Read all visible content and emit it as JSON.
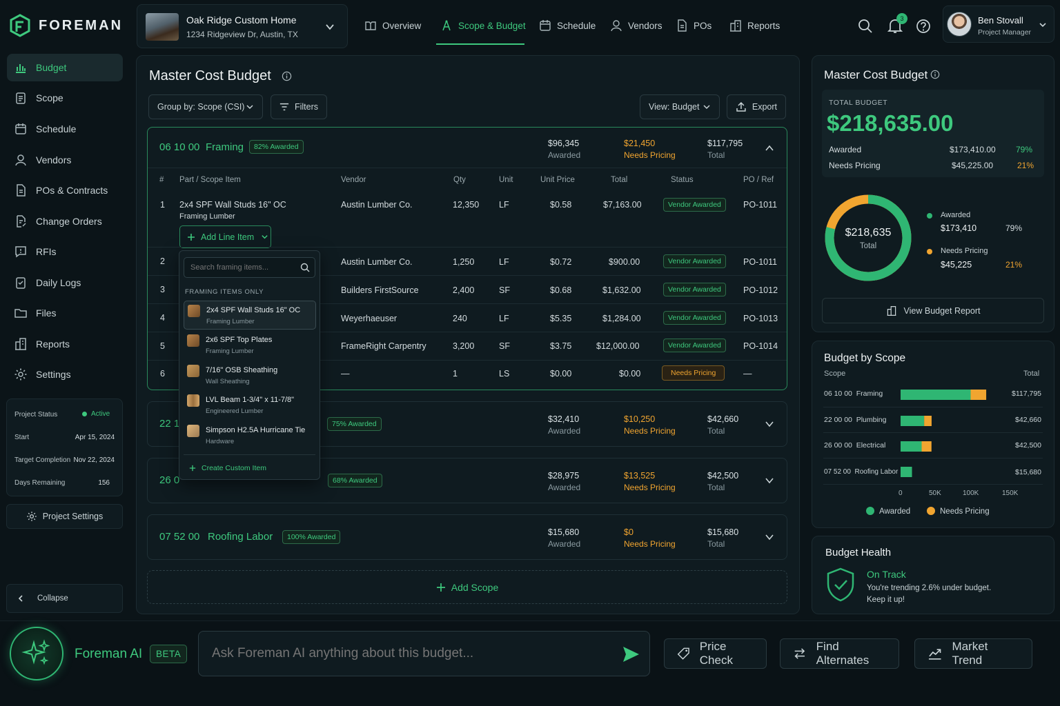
{
  "brand": {
    "name": "FOREMAN"
  },
  "project": {
    "name": "Oak Ridge Custom Home",
    "address": "1234 Ridgeview Dr, Austin, TX"
  },
  "topnav": [
    {
      "label": "Overview"
    },
    {
      "label": "Scope & Budget"
    },
    {
      "label": "Schedule"
    },
    {
      "label": "Vendors"
    },
    {
      "label": "POs"
    },
    {
      "label": "Reports"
    }
  ],
  "notifications": {
    "count": "3"
  },
  "user": {
    "name": "Ben Stovall",
    "role": "Project Manager"
  },
  "sidebar": {
    "items": [
      {
        "label": "Budget"
      },
      {
        "label": "Scope"
      },
      {
        "label": "Schedule"
      },
      {
        "label": "Vendors"
      },
      {
        "label": "POs & Contracts"
      },
      {
        "label": "Change Orders"
      },
      {
        "label": "RFIs"
      },
      {
        "label": "Daily Logs"
      },
      {
        "label": "Files"
      },
      {
        "label": "Reports"
      },
      {
        "label": "Settings"
      }
    ],
    "status": {
      "project_status_label": "Project Status",
      "project_status": "Active",
      "start_label": "Start",
      "start": "Apr 15, 2024",
      "target_label": "Target Completion",
      "target": "Nov 22, 2024",
      "days_label": "Days Remaining",
      "days": "156"
    },
    "project_settings": "Project Settings",
    "collapse": "Collapse"
  },
  "main": {
    "title": "Master Cost Budget",
    "group_by_label": "Group by:",
    "group_by_value": "Scope (CSI)",
    "filters": "Filters",
    "view_label": "View:",
    "view_value": "Budget",
    "export": "Export",
    "add_scope": "Add Scope"
  },
  "scopes": [
    {
      "code": "06 10 00",
      "name": "Framing",
      "awarded_pct": "82% Awarded",
      "awarded": "$96,345",
      "awarded_label": "Awarded",
      "needs": "$21,450",
      "needs_label": "Needs Pricing",
      "total": "$117,795",
      "total_label": "Total"
    },
    {
      "code": "22 1",
      "name": "",
      "awarded_pct": "75% Awarded",
      "awarded": "$32,410",
      "awarded_label": "Awarded",
      "needs": "$10,250",
      "needs_label": "Needs Pricing",
      "total": "$42,660",
      "total_label": "Total"
    },
    {
      "code": "26 0",
      "name": "",
      "awarded_pct": "68% Awarded",
      "awarded": "$28,975",
      "awarded_label": "Awarded",
      "needs": "$13,525",
      "needs_label": "Needs Pricing",
      "total": "$42,500",
      "total_label": "Total"
    },
    {
      "code": "07 52 00",
      "name": "Roofing Labor",
      "awarded_pct": "100% Awarded",
      "awarded": "$15,680",
      "awarded_label": "Awarded",
      "needs": "$0",
      "needs_label": "Needs Pricing",
      "total": "$15,680",
      "total_label": "Total"
    }
  ],
  "table": {
    "headers": [
      "#",
      "Part / Scope Item",
      "Vendor",
      "Qty",
      "Unit",
      "Unit Price",
      "Total",
      "Status",
      "PO / Ref"
    ],
    "rows": [
      {
        "n": "1",
        "item": "2x4 SPF Wall Studs 16\" OC",
        "sub": "Framing Lumber",
        "vendor": "Austin Lumber Co.",
        "qty": "12,350",
        "unit": "LF",
        "price": "$0.58",
        "total": "$7,163.00",
        "status": "Vendor Awarded",
        "po": "PO-1011"
      },
      {
        "n": "2",
        "vendor": "Austin Lumber Co.",
        "qty": "1,250",
        "unit": "LF",
        "price": "$0.72",
        "total": "$900.00",
        "status": "Vendor Awarded",
        "po": "PO-1011"
      },
      {
        "n": "3",
        "vendor": "Builders FirstSource",
        "qty": "2,400",
        "unit": "SF",
        "price": "$0.68",
        "total": "$1,632.00",
        "status": "Vendor Awarded",
        "po": "PO-1012"
      },
      {
        "n": "4",
        "vendor": "Weyerhaeuser",
        "qty": "240",
        "unit": "LF",
        "price": "$5.35",
        "total": "$1,284.00",
        "status": "Vendor Awarded",
        "po": "PO-1013"
      },
      {
        "n": "5",
        "vendor": "FrameRight Carpentry",
        "qty": "3,200",
        "unit": "SF",
        "price": "$3.75",
        "total": "$12,000.00",
        "status": "Vendor Awarded",
        "po": "PO-1014"
      },
      {
        "n": "6",
        "vendor": "—",
        "qty": "1",
        "unit": "LS",
        "price": "$0.00",
        "total": "$0.00",
        "status": "Needs Pricing",
        "po": "—"
      }
    ],
    "add_line_item": "Add Line Item"
  },
  "dropdown": {
    "search_placeholder": "Search framing items...",
    "section": "FRAMING ITEMS ONLY",
    "items": [
      {
        "name": "2x4 SPF Wall Studs 16\" OC",
        "cat": "Framing Lumber"
      },
      {
        "name": "2x6 SPF Top Plates",
        "cat": "Framing Lumber"
      },
      {
        "name": "7/16\" OSB Sheathing",
        "cat": "Wall Sheathing"
      },
      {
        "name": "LVL Beam 1-3/4\" x 11-7/8\"",
        "cat": "Engineered Lumber"
      },
      {
        "name": "Simpson H2.5A Hurricane Tie",
        "cat": "Hardware"
      }
    ],
    "create": "Create Custom Item"
  },
  "summary": {
    "title": "Master Cost Budget",
    "total_label": "TOTAL BUDGET",
    "total": "$218,635.00",
    "awarded_label": "Awarded",
    "awarded": "$173,410.00",
    "awarded_pct": "79%",
    "needs_label": "Needs Pricing",
    "needs": "$45,225.00",
    "needs_pct": "21%",
    "donut_value": "$218,635",
    "donut_label": "Total",
    "legend_awarded": "$173,410",
    "legend_needs": "$45,225",
    "awarded_fraction": 0.79,
    "view_report": "View Budget Report"
  },
  "budget_by_scope": {
    "title": "Budget by Scope",
    "col_scope": "Scope",
    "col_total": "Total",
    "axis": [
      "0",
      "50K",
      "100K",
      "150K"
    ],
    "legend_awarded": "Awarded",
    "legend_needs": "Needs Pricing"
  },
  "chart_data": {
    "type": "bar",
    "orientation": "horizontal",
    "stacked": true,
    "categories": [
      "06 10 00  Framing",
      "22 00 00  Plumbing",
      "26 00 00  Electrical",
      "07 52 00  Roofing Labor"
    ],
    "totals": [
      "$117,795",
      "$42,660",
      "$42,500",
      "$15,680"
    ],
    "series": [
      {
        "name": "Awarded",
        "values": [
          96345,
          32410,
          28975,
          15680
        ],
        "color": "#2fb673"
      },
      {
        "name": "Needs Pricing",
        "values": [
          21450,
          10250,
          13525,
          0
        ],
        "color": "#f1a530"
      }
    ],
    "xlim": [
      0,
      150000
    ]
  },
  "health": {
    "title": "Budget Health",
    "status": "On Track",
    "message": "You're trending 2.6% under budget.",
    "message2": "Keep it up!"
  },
  "ai": {
    "name": "Foreman AI",
    "beta": "BETA",
    "placeholder": "Ask Foreman AI anything about this budget...",
    "actions": [
      "Price Check",
      "Find Alternates",
      "Market Trend"
    ]
  },
  "colors": {
    "accent": "#3ec97e",
    "warning": "#f1a530",
    "bg": "#0b1418"
  }
}
